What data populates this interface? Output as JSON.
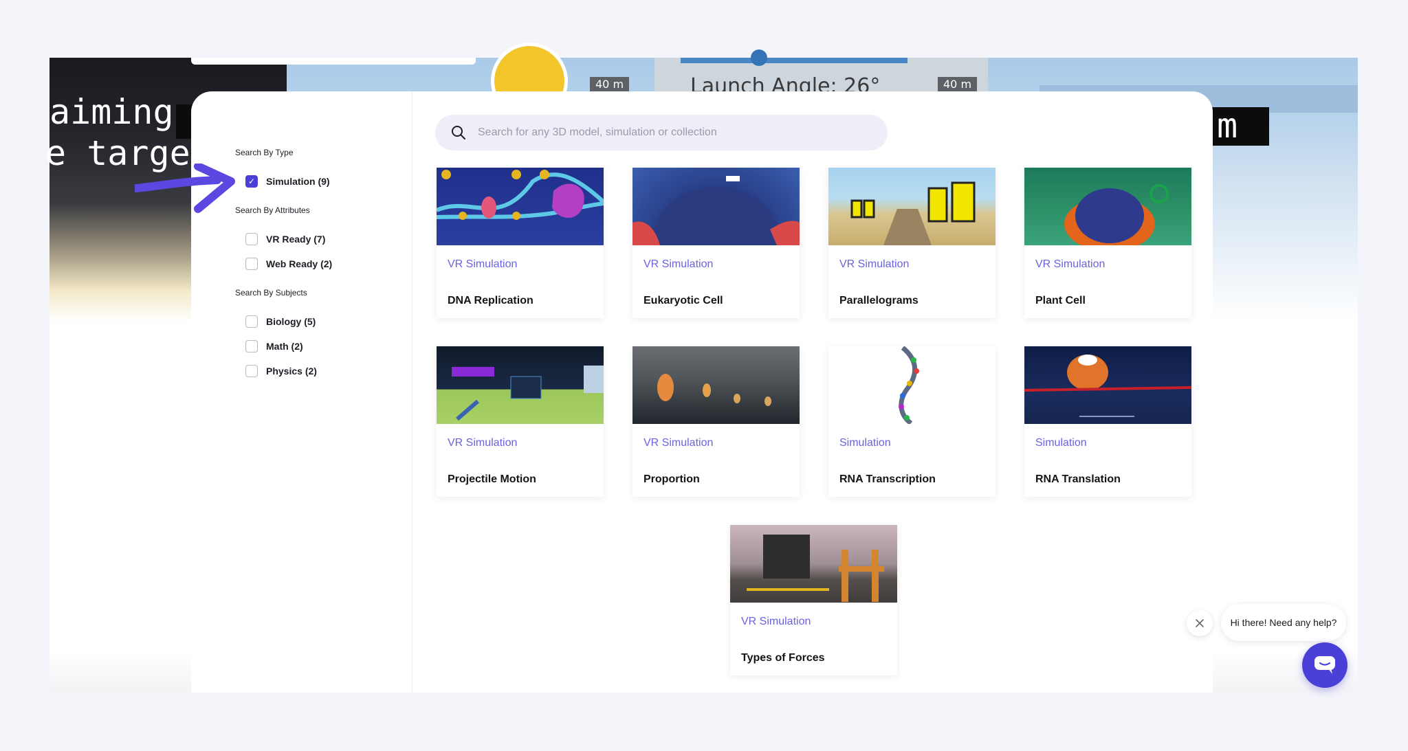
{
  "background": {
    "overlay_texts": [
      "aiming",
      "e target",
      "m"
    ],
    "distance_labels": [
      "40 m",
      "40 m"
    ],
    "launch_angle": "Launch Angle:    26°"
  },
  "sidebar": {
    "type_title": "Search By Type",
    "type_filters": [
      {
        "label": "Simulation (9)",
        "checked": true
      }
    ],
    "attr_title": "Search By Attributes",
    "attr_filters": [
      {
        "label": "VR Ready (7)",
        "checked": false
      },
      {
        "label": "Web Ready (2)",
        "checked": false
      }
    ],
    "subject_title": "Search By Subjects",
    "subject_filters": [
      {
        "label": "Biology (5)",
        "checked": false
      },
      {
        "label": "Math (2)",
        "checked": false
      },
      {
        "label": "Physics (2)",
        "checked": false
      }
    ]
  },
  "search": {
    "placeholder": "Search for any 3D model, simulation or collection",
    "value": ""
  },
  "cards": [
    {
      "type": "VR Simulation",
      "title": "DNA Replication",
      "thumb": "dna"
    },
    {
      "type": "VR Simulation",
      "title": "Eukaryotic Cell",
      "thumb": "euk"
    },
    {
      "type": "VR Simulation",
      "title": "Parallelograms",
      "thumb": "para"
    },
    {
      "type": "VR Simulation",
      "title": "Plant Cell",
      "thumb": "plant"
    },
    {
      "type": "VR Simulation",
      "title": "Projectile Motion",
      "thumb": "proj"
    },
    {
      "type": "VR Simulation",
      "title": "Proportion",
      "thumb": "prop"
    },
    {
      "type": "Simulation",
      "title": "RNA Transcription",
      "thumb": "rna"
    },
    {
      "type": "Simulation",
      "title": "RNA Translation",
      "thumb": "rnat"
    },
    {
      "type": "VR Simulation",
      "title": "Types of Forces",
      "thumb": "forces"
    }
  ],
  "chat": {
    "greeting": "Hi there! Need any help?",
    "close_icon": "close-icon",
    "launcher_icon": "chat-icon"
  },
  "colors": {
    "accent": "#4a3fd6",
    "type_label": "#6a62e0"
  }
}
